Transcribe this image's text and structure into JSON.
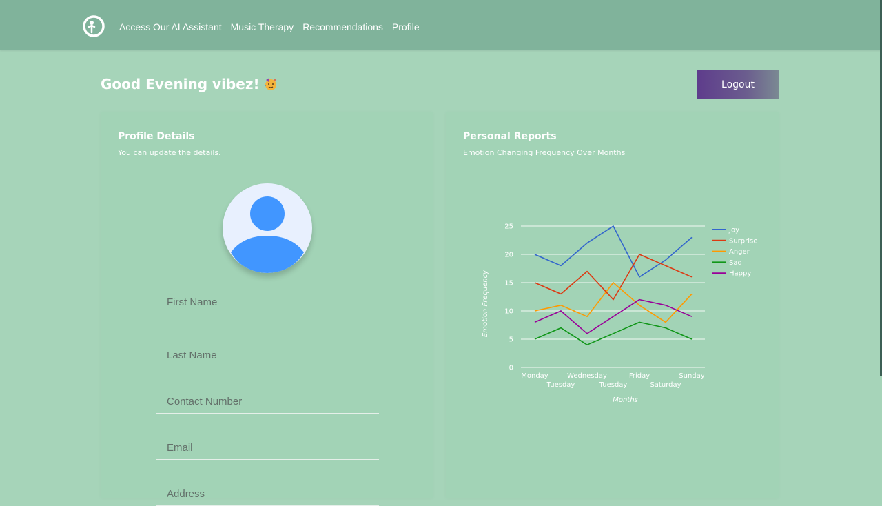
{
  "nav": {
    "links": [
      "Access Our AI Assistant",
      "Music Therapy",
      "Recommendations",
      "Profile"
    ]
  },
  "greeting": "Good Evening vibez!",
  "logout_label": "Logout",
  "profile": {
    "title": "Profile Details",
    "subtitle": "You can update the details.",
    "fields": [
      {
        "placeholder": "First Name",
        "value": ""
      },
      {
        "placeholder": "Last Name",
        "value": ""
      },
      {
        "placeholder": "Contact Number",
        "value": ""
      },
      {
        "placeholder": "Email",
        "value": ""
      },
      {
        "placeholder": "Address",
        "value": ""
      }
    ]
  },
  "reports": {
    "title": "Personal Reports",
    "subtitle": "Emotion Changing Frequency Over Months"
  },
  "chart_data": {
    "type": "line",
    "title": "",
    "xlabel": "Months",
    "ylabel": "Emotion Frequency",
    "categories": [
      "Monday",
      "Tuesday",
      "Wednesday",
      "Tuesday",
      "Friday",
      "Saturday",
      "Sunday"
    ],
    "ylim": [
      0,
      25
    ],
    "yticks": [
      0,
      5,
      10,
      15,
      20,
      25
    ],
    "grid": true,
    "legend_position": "right",
    "series": [
      {
        "name": "Joy",
        "color": "#3366cc",
        "values": [
          20,
          18,
          22,
          25,
          16,
          19,
          23
        ]
      },
      {
        "name": "Surprise",
        "color": "#dc3912",
        "values": [
          15,
          13,
          17,
          12,
          20,
          18,
          16
        ]
      },
      {
        "name": "Anger",
        "color": "#ff9900",
        "values": [
          10,
          11,
          9,
          15,
          11,
          8,
          13
        ]
      },
      {
        "name": "Sad",
        "color": "#109618",
        "values": [
          5,
          7,
          4,
          6,
          8,
          7,
          5
        ]
      },
      {
        "name": "Happy",
        "color": "#990099",
        "values": [
          8,
          10,
          6,
          9,
          12,
          11,
          9
        ]
      }
    ]
  }
}
